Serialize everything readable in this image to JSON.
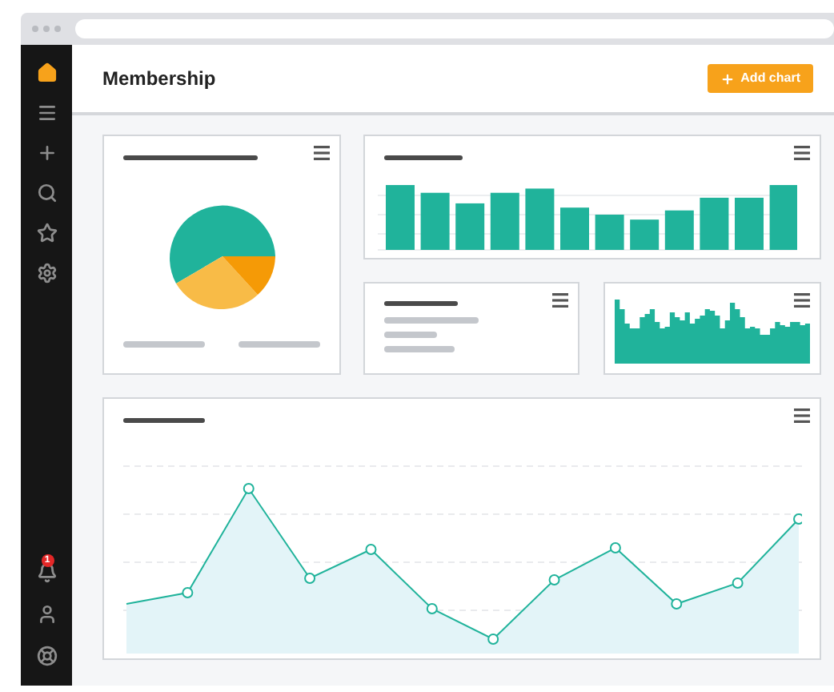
{
  "sidebar": {
    "items": [
      {
        "selected": true
      },
      {
        "selected": false
      },
      {
        "selected": false
      },
      {
        "selected": false
      },
      {
        "selected": false
      },
      {
        "selected": false
      }
    ],
    "notification_badge": "1"
  },
  "header": {
    "title": "Membership",
    "button": "Add chart"
  },
  "cards": [
    {
      "kind": "pie"
    },
    {
      "kind": "bars"
    },
    {
      "kind": "text"
    },
    {
      "kind": "histogram"
    },
    {
      "kind": "line"
    }
  ]
}
